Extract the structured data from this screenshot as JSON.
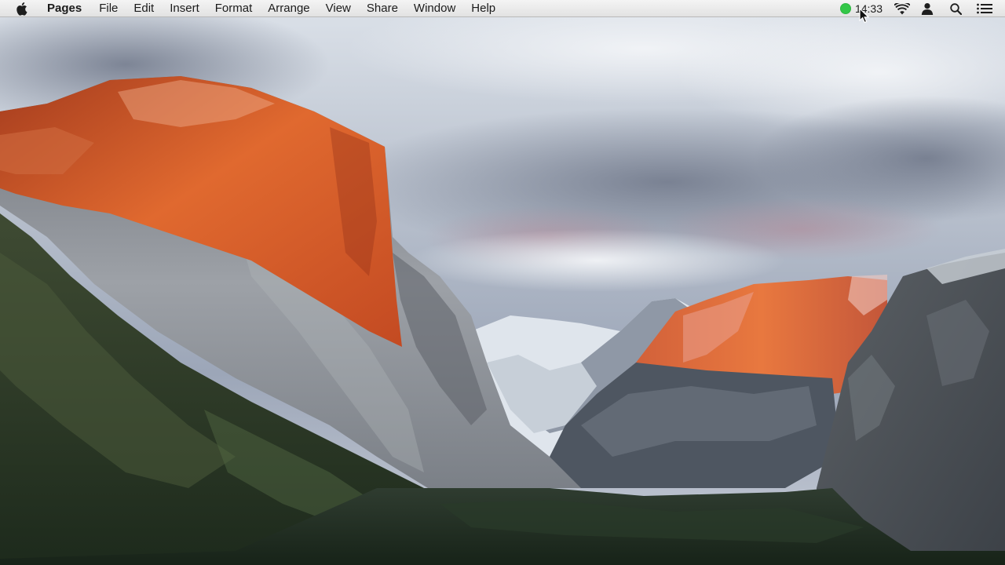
{
  "menubar": {
    "app_name": "Pages",
    "items": [
      "File",
      "Edit",
      "Insert",
      "Format",
      "Arrange",
      "View",
      "Share",
      "Window",
      "Help"
    ],
    "clock": "14:33",
    "status_dot_color": "#33c748",
    "icons": [
      "apple-icon",
      "wifi-icon",
      "user-icon",
      "spotlight-search-icon",
      "notification-center-icon"
    ]
  },
  "desktop": {
    "wallpaper": "mountain-valley-sunset"
  }
}
